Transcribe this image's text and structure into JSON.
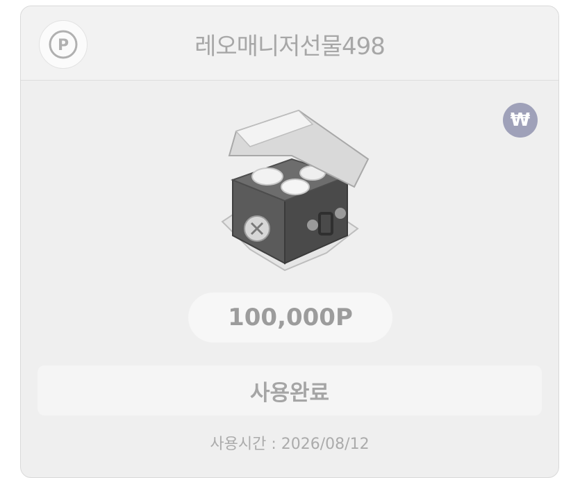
{
  "header": {
    "title": "레오매니저선물498",
    "point_symbol": "P"
  },
  "badge": {
    "currency_symbol": "₩"
  },
  "reward": {
    "amount": "100,000P"
  },
  "action": {
    "button_label": "사용완료"
  },
  "footer": {
    "usage_time_label": "사용시간",
    "separator": " : ",
    "usage_date": "2026/08/12"
  },
  "colors": {
    "card_bg": "#efefef",
    "badge_bg": "#9fa1b9",
    "text_muted": "#a7a7a7"
  },
  "icons": [
    "point-coin-icon",
    "won-currency-icon",
    "treasure-chest-icon"
  ]
}
